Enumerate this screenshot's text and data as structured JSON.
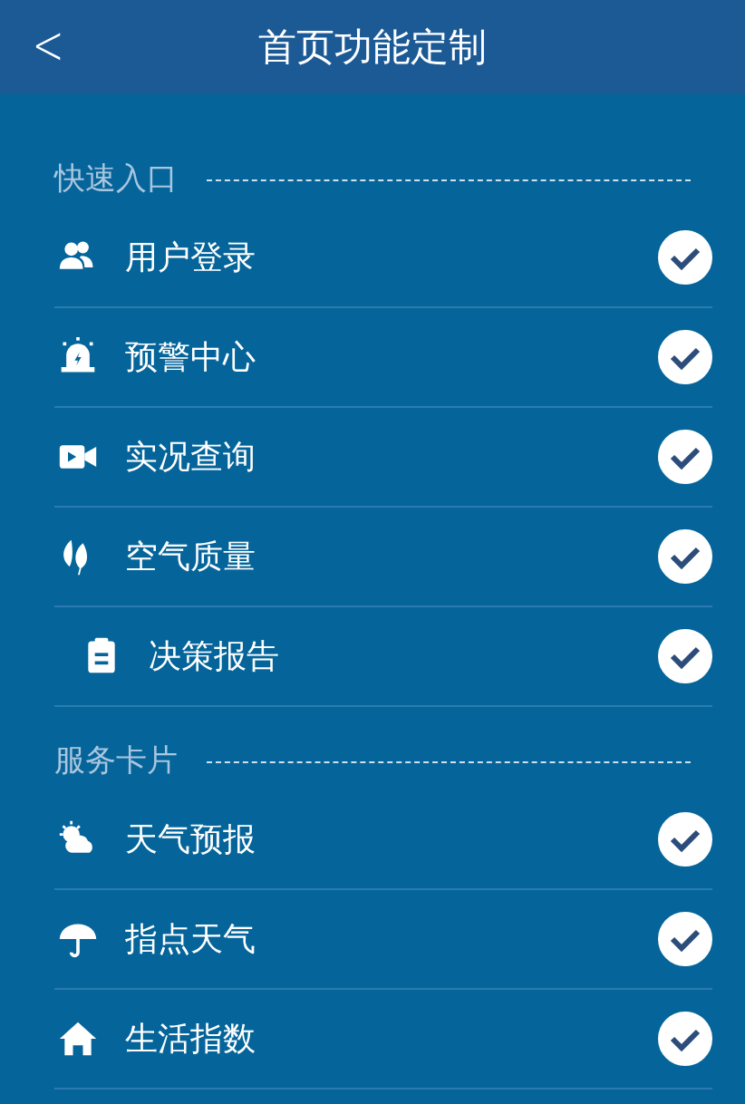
{
  "header": {
    "back_label": "<",
    "title": "首页功能定制"
  },
  "sections": [
    {
      "title": "快速入口",
      "items": [
        {
          "label": "用户登录",
          "checked": true
        },
        {
          "label": "预警中心",
          "checked": true
        },
        {
          "label": "实况查询",
          "checked": true
        },
        {
          "label": "空气质量",
          "checked": true
        },
        {
          "label": "决策报告",
          "checked": true
        }
      ]
    },
    {
      "title": "服务卡片",
      "items": [
        {
          "label": "天气预报",
          "checked": true
        },
        {
          "label": "指点天气",
          "checked": true
        },
        {
          "label": "生活指数",
          "checked": true
        }
      ]
    }
  ]
}
